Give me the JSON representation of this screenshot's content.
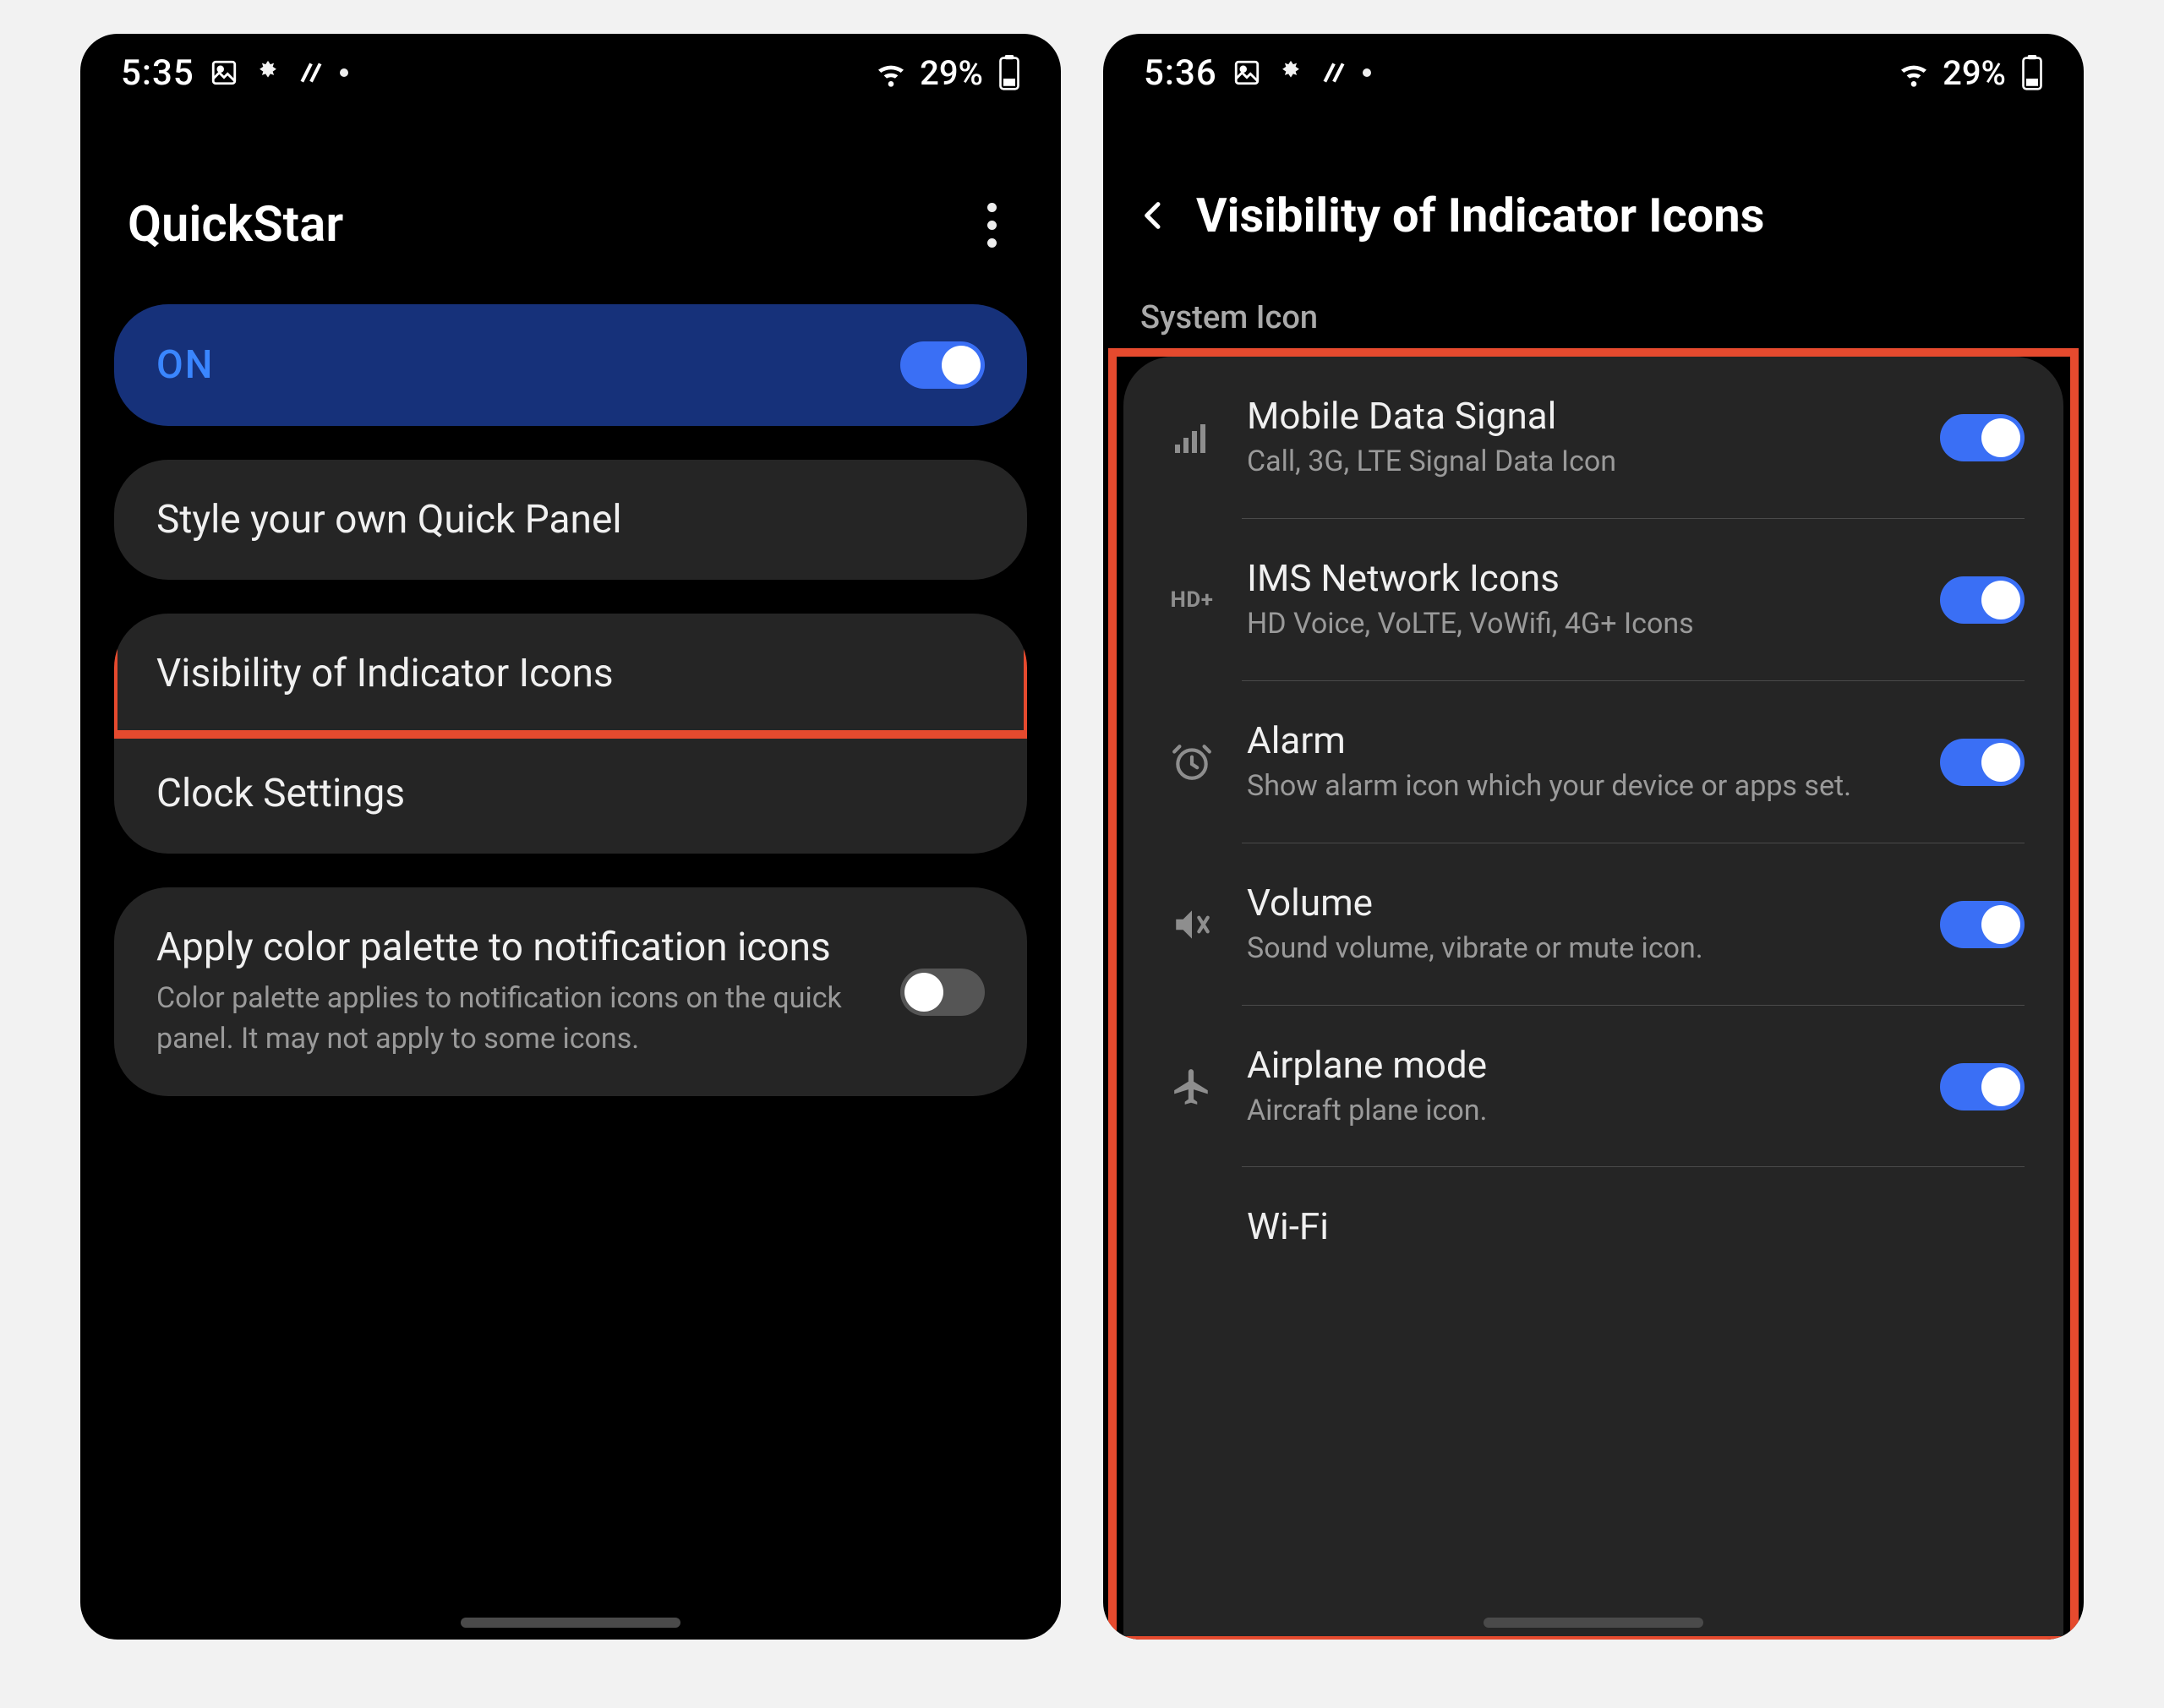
{
  "screen1": {
    "statusbar": {
      "time": "5:35",
      "battery": "29%"
    },
    "header": {
      "title": "QuickStar"
    },
    "onCard": {
      "label": "ON"
    },
    "styleCard": {
      "label": "Style your own Quick Panel"
    },
    "visibilityRow": {
      "label": "Visibility of Indicator Icons"
    },
    "clockRow": {
      "label": "Clock Settings"
    },
    "paletteCard": {
      "title": "Apply color palette to notification icons",
      "sub": "Color palette applies to notification icons on the quick panel. It may not apply to some icons."
    }
  },
  "screen2": {
    "statusbar": {
      "time": "5:36",
      "battery": "29%"
    },
    "header": {
      "title": "Visibility of Indicator Icons"
    },
    "sectionLabel": "System Icon",
    "items": [
      {
        "title": "Mobile Data Signal",
        "sub": "Call, 3G, LTE Signal Data Icon",
        "icon": "signal"
      },
      {
        "title": "IMS Network Icons",
        "sub": "HD Voice, VoLTE, VoWifi, 4G+ Icons",
        "icon": "hdplus"
      },
      {
        "title": "Alarm",
        "sub": "Show alarm icon which your device or apps set.",
        "icon": "alarm"
      },
      {
        "title": "Volume",
        "sub": "Sound volume, vibrate or mute icon.",
        "icon": "volume"
      },
      {
        "title": "Airplane mode",
        "sub": "Aircraft plane icon.",
        "icon": "airplane"
      },
      {
        "title": "Wi-Fi",
        "sub": "",
        "icon": "wifi"
      }
    ]
  }
}
